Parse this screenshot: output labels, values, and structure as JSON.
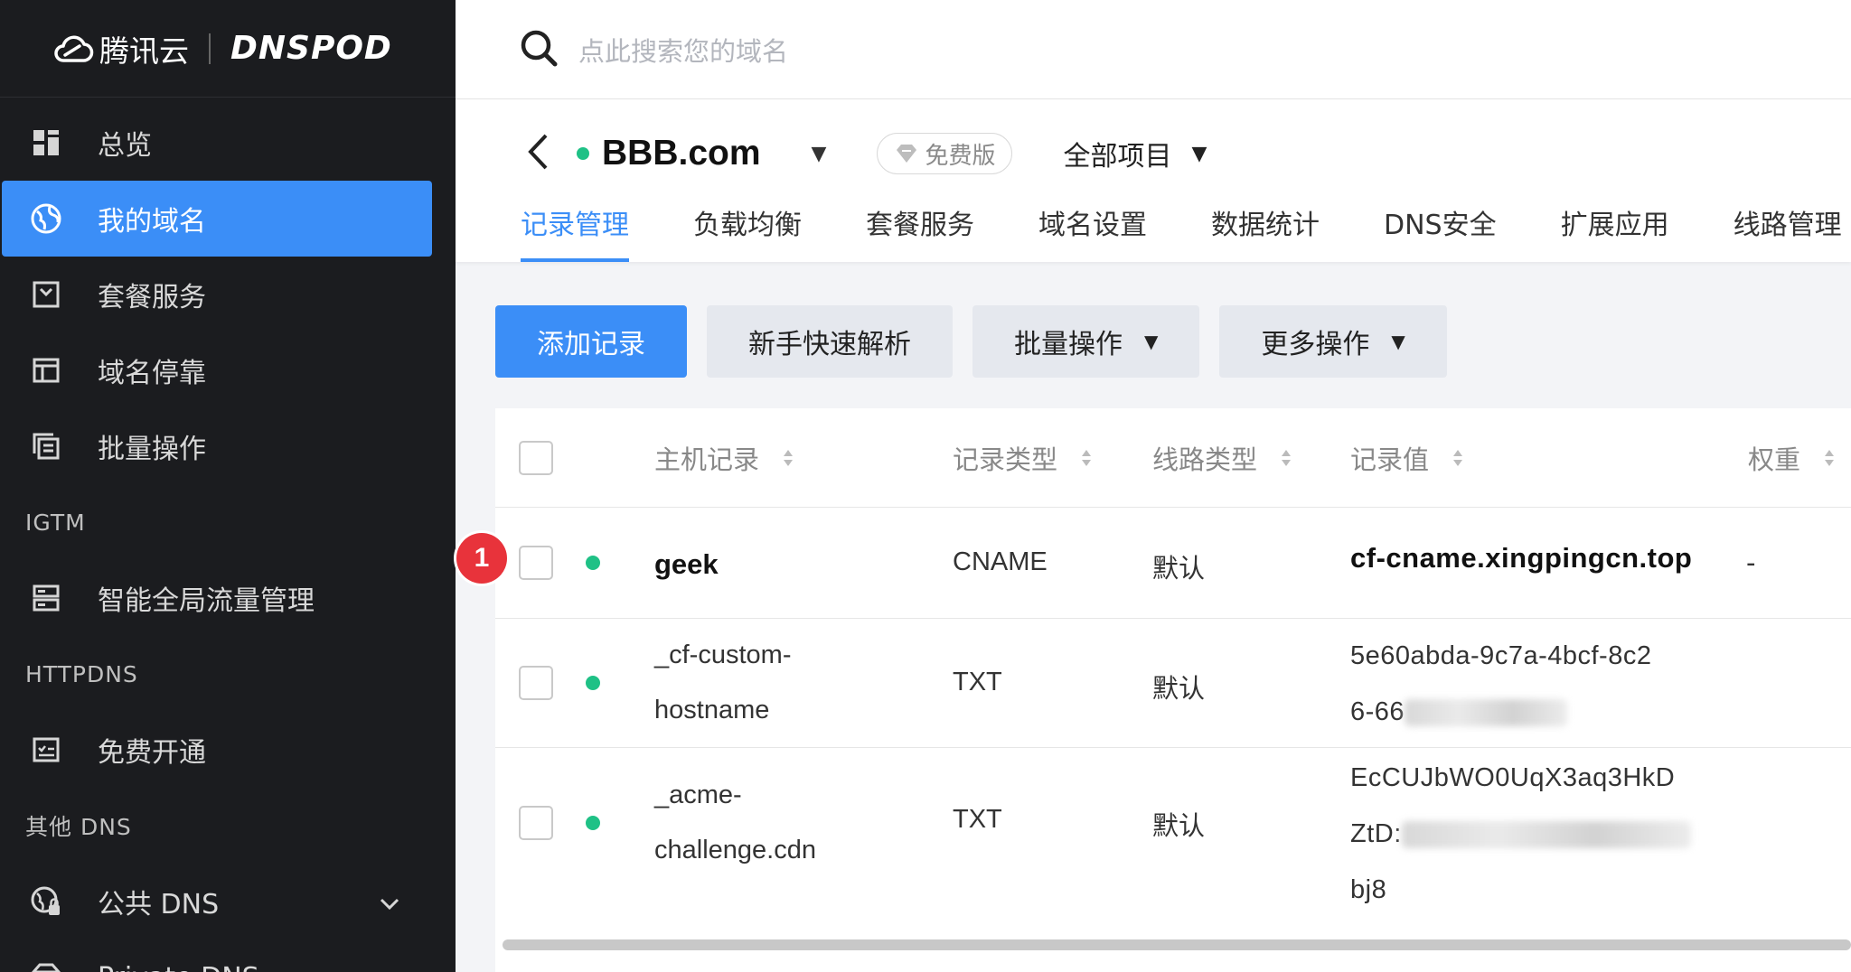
{
  "brand": {
    "cloud_text": "腾讯云",
    "product": "DNSPOD"
  },
  "sidebar": {
    "items": [
      {
        "label": "总览",
        "icon": "grid-icon"
      },
      {
        "label": "我的域名",
        "icon": "globe-icon",
        "active": true
      },
      {
        "label": "套餐服务",
        "icon": "package-icon"
      },
      {
        "label": "域名停靠",
        "icon": "layout-icon"
      },
      {
        "label": "批量操作",
        "icon": "stack-icon"
      }
    ],
    "section_igtm": "IGTM",
    "igtm_item": "智能全局流量管理",
    "section_httpdns": "HTTPDNS",
    "httpdns_item": "免费开通",
    "section_other": "其他 DNS",
    "public_dns": "公共 DNS",
    "private_dns": "Private DNS"
  },
  "search": {
    "placeholder": "点此搜索您的域名"
  },
  "domain": {
    "name": "BBB.com",
    "plan": "免费版",
    "project": "全部项目"
  },
  "tabs": [
    "记录管理",
    "负载均衡",
    "套餐服务",
    "域名设置",
    "数据统计",
    "DNS安全",
    "扩展应用",
    "线路管理"
  ],
  "actions": {
    "add": "添加记录",
    "quick": "新手快速解析",
    "batch": "批量操作",
    "more": "更多操作"
  },
  "table": {
    "headers": {
      "host": "主机记录",
      "type": "记录类型",
      "line": "线路类型",
      "value": "记录值",
      "weight": "权重"
    },
    "rows": [
      {
        "host": "geek",
        "type": "CNAME",
        "line": "默认",
        "value": "cf-cname.xingpingcn.top",
        "weight": "-"
      },
      {
        "host1": "_cf-custom-",
        "host2": "hostname",
        "type": "TXT",
        "line": "默认",
        "value1": "5e60abda-9c7a-4bcf-8c2",
        "value2": "6-66"
      },
      {
        "host1": "_acme-",
        "host2": "challenge.cdn",
        "type": "TXT",
        "line": "默认",
        "value1": "EcCUJbWO0UqX3aq3HkD",
        "value2": "ZtD:",
        "value3": "bj8"
      }
    ]
  },
  "step_badge": "1",
  "colors": {
    "accent": "#3b8ef7",
    "sidebar_bg": "#1b1c1f",
    "status_green": "#1fc186",
    "badge_red": "#e8333b"
  }
}
